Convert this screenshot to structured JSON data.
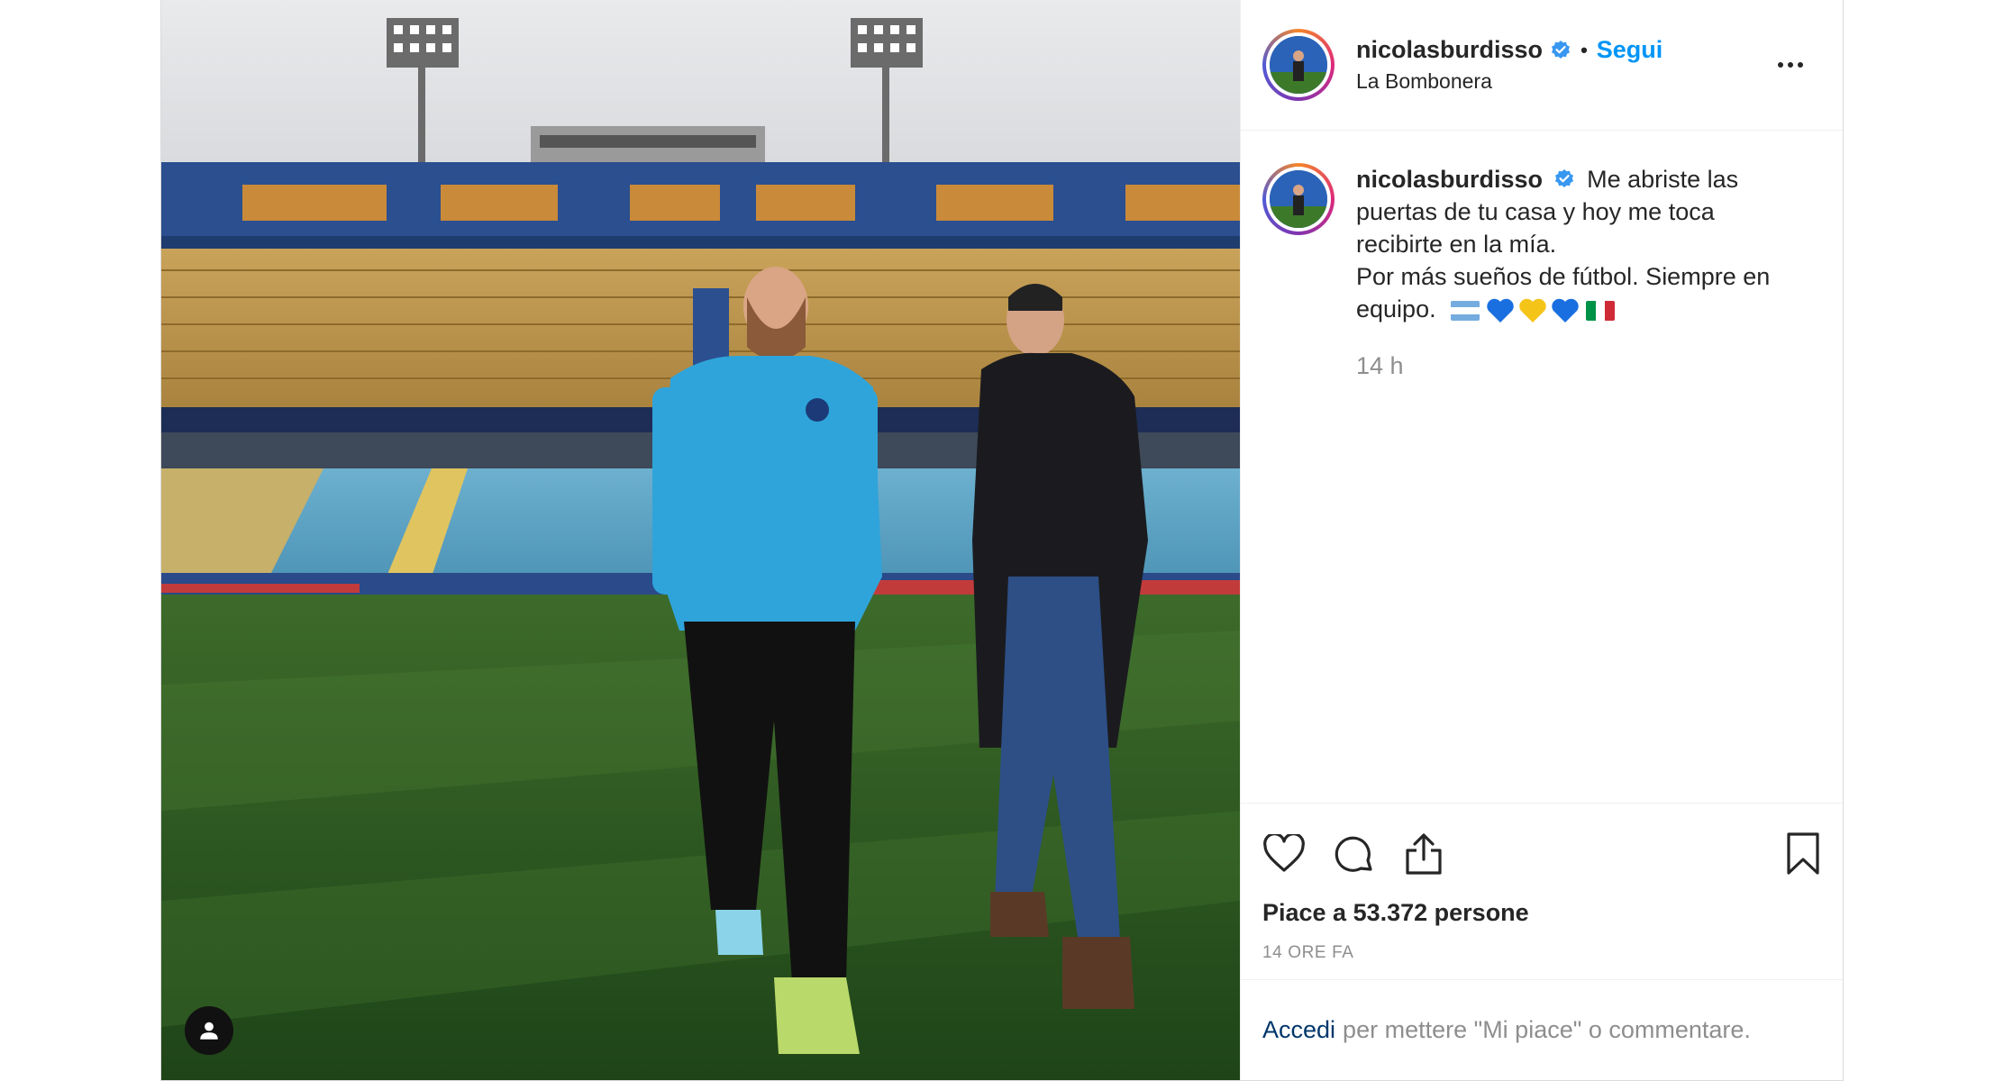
{
  "header": {
    "username": "nicolasburdisso",
    "dot": "•",
    "follow_label": "Segui",
    "location": "La Bombonera",
    "more_icon": "more-horizontal-icon"
  },
  "caption": {
    "username": "nicolasburdisso",
    "line1": "Me abriste las",
    "line2": "puertas de tu casa y hoy me toca",
    "line3": "recibirte en la mía.",
    "line4": "Por más sueños de fútbol. Siempre en",
    "line5": "equipo.",
    "emojis": [
      "flag-argentina",
      "blue-heart",
      "yellow-heart",
      "blue-heart",
      "flag-italy"
    ],
    "time": "14 h"
  },
  "actions": {
    "icons": [
      "heart-icon",
      "comment-icon",
      "share-icon",
      "bookmark-icon"
    ],
    "likes": "Piace a 53.372 persone",
    "ago": "14 ORE FA"
  },
  "login": {
    "link": "Accedi",
    "text": "per mettere \"Mi piace\" o commentare."
  },
  "colors": {
    "accent": "#0095f6",
    "verified": "#3897f0",
    "link_dark": "#00376b",
    "muted": "#8e8e8e"
  }
}
